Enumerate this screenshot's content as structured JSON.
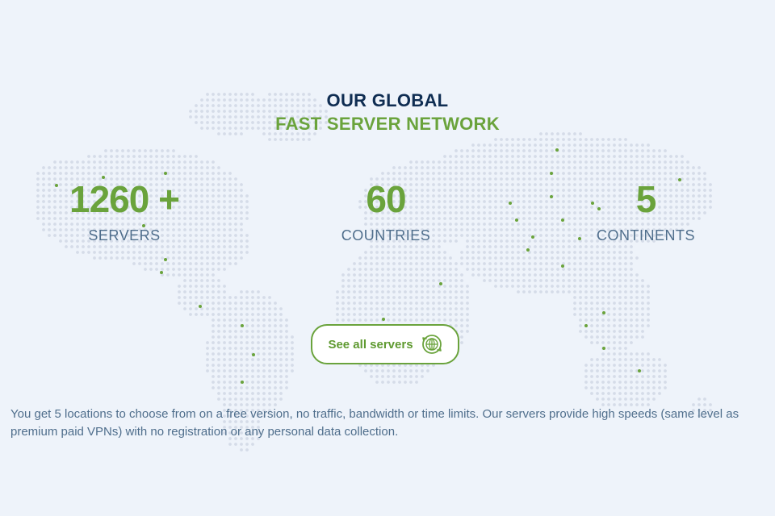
{
  "heading": {
    "line1": "OUR GLOBAL",
    "line2": "FAST SERVER NETWORK"
  },
  "stats": {
    "servers": {
      "value": "1260 +",
      "label": "SERVERS"
    },
    "countries": {
      "value": "60",
      "label": "COUNTRIES"
    },
    "continents": {
      "value": "5",
      "label": "CONTINENTS"
    }
  },
  "cta": {
    "label": "See all servers",
    "icon": "globe-icon"
  },
  "description": "You get 5 locations to choose from on a free version, no traffic, bandwidth or time limits. Our servers provide high speeds (same level as premium paid VPNs) with no registration or any personal data collection.",
  "colors": {
    "background": "#eef3fa",
    "accent_green": "#6aa33c",
    "navy": "#0f2d52",
    "muted_blue": "#4f6e8c",
    "map_dot": "#d5dce8"
  }
}
